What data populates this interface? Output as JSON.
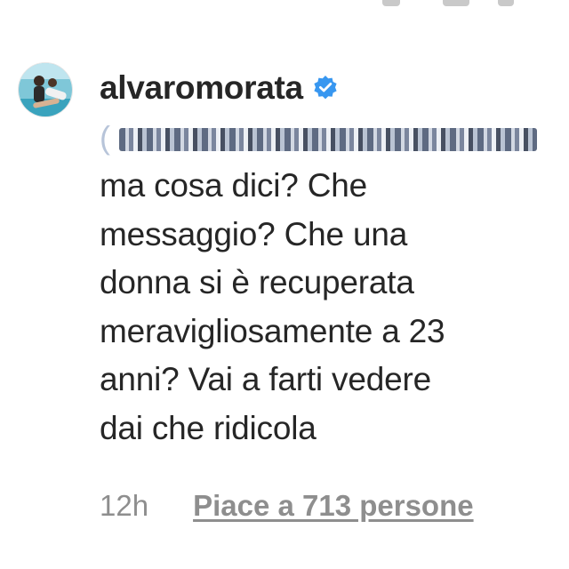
{
  "comment": {
    "username": "alvaromorata",
    "verified": true,
    "verified_icon": "verified-badge-icon",
    "mention_prefix": "(",
    "text": "ma cosa dici? Che\nmessaggio? Che una\ndonna si è recuperata\nmeravigliosamente a 23\nanni? Vai a farti vedere\ndai che ridicola",
    "time": "12h",
    "likes": "Piace a 713 persone"
  },
  "colors": {
    "text": "#262626",
    "muted": "#8e8e8e",
    "verified": "#3897f0"
  }
}
